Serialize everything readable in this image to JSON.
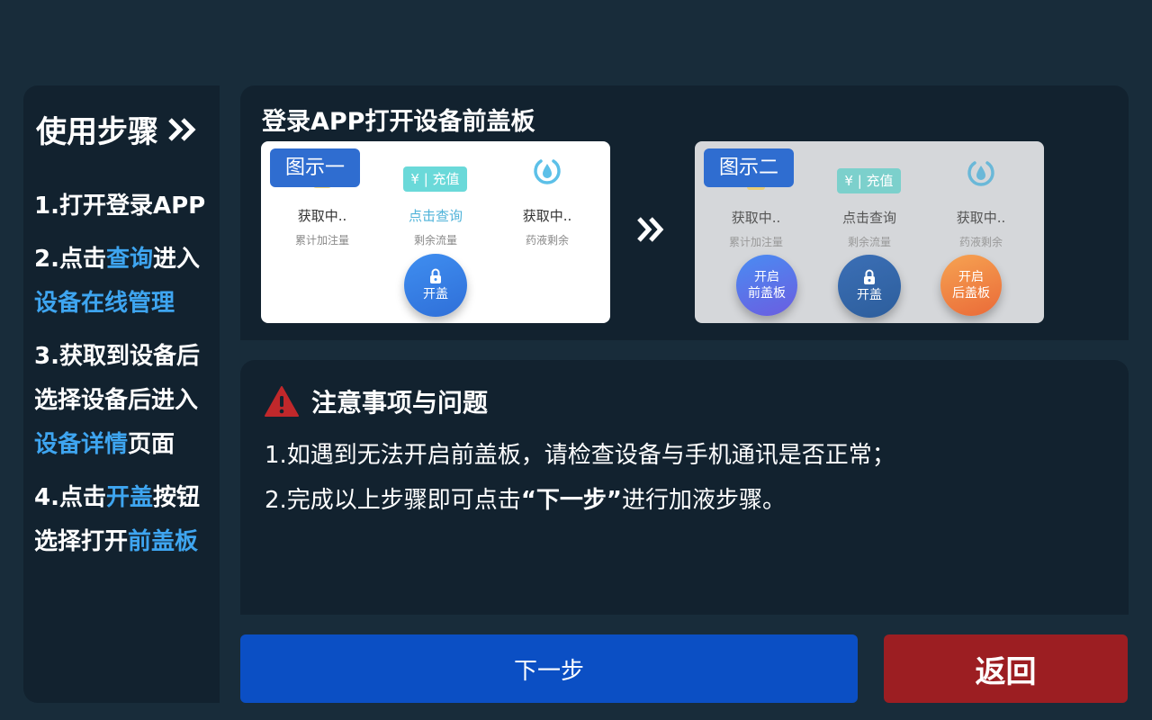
{
  "sidebar": {
    "title": "使用步骤",
    "steps": [
      {
        "lines": [
          {
            "parts": [
              "1.打开登录APP"
            ]
          }
        ]
      },
      {
        "lines": [
          {
            "parts": [
              "2.点击",
              "查询",
              "进入"
            ]
          },
          {
            "parts": [
              "设备在线管理"
            ]
          }
        ]
      },
      {
        "lines": [
          {
            "parts": [
              "3.获取到设备后"
            ]
          },
          {
            "parts": [
              "选择设备后进入"
            ]
          },
          {
            "parts": [
              "设备详情",
              "页面"
            ]
          }
        ]
      },
      {
        "lines": [
          {
            "parts": [
              "4.点击",
              "开盖",
              "按钮"
            ]
          },
          {
            "parts": [
              "选择打开",
              "前盖板"
            ]
          }
        ]
      }
    ]
  },
  "instructions": {
    "title": "登录APP打开设备前盖板",
    "figure1": {
      "badge": "图示一",
      "recharge_label": "¥ | 充值",
      "col1_main": "获取中..",
      "col1_sub": "累计加注量",
      "col2_main": "点击查询",
      "col2_sub": "剩余流量",
      "col3_main": "获取中..",
      "col3_sub": "药液剩余",
      "open_lid_label": "开盖"
    },
    "figure2": {
      "badge": "图示二",
      "recharge_label": "¥ | 充值",
      "col1_main": "获取中..",
      "col1_sub": "累计加注量",
      "col2_main": "点击查询",
      "col2_sub": "剩余流量",
      "col3_main": "获取中..",
      "col3_sub": "药液剩余",
      "front_btn_l1": "开启",
      "front_btn_l2": "前盖板",
      "open_lid_label": "开盖",
      "rear_btn_l1": "开启",
      "rear_btn_l2": "后盖板"
    }
  },
  "notes": {
    "title": "注意事项与问题",
    "line1": "1.如遇到无法开启前盖板，请检查设备与手机通讯是否正常；",
    "line2_pre": "2.完成以上步骤即可点击",
    "line2_open_quote": "“",
    "line2_bold": "下一步",
    "line2_close_quote": "”",
    "line2_post": "进行加液步骤。"
  },
  "buttons": {
    "next_label": "下一步",
    "back_label": "返回"
  },
  "colors": {
    "background": "#182c3a",
    "panel": "#12222f",
    "highlight": "#3ea5f0",
    "next_button": "#0b4fc4",
    "back_button": "#9c1e22",
    "warning": "#c0282b"
  },
  "icons": [
    "double-chevron-right-icon",
    "coin-icon",
    "water-drop-icon",
    "lock-icon",
    "warning-icon"
  ]
}
